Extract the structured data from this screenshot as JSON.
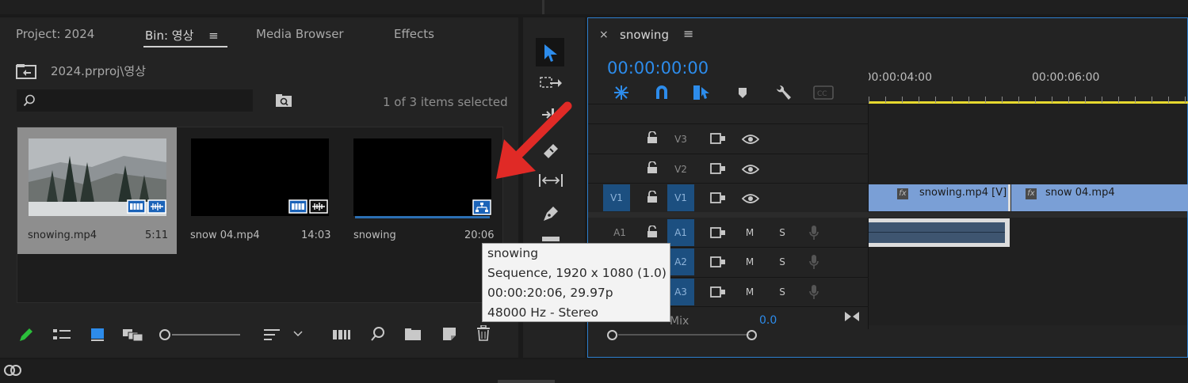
{
  "project_panel": {
    "tabs": [
      "Project: 2024",
      "Bin: 영상",
      "Media Browser",
      "Effects"
    ],
    "active_tab": "Bin: 영상",
    "path": "2024.prproj\\영상",
    "search_placeholder": "",
    "selection_status": "1 of 3 items selected",
    "clips": [
      {
        "name": "snowing.mp4",
        "duration": "5:11",
        "selected": true
      },
      {
        "name": "snow 04.mp4",
        "duration": "14:03",
        "selected": false
      },
      {
        "name": "snowing",
        "duration": "20:06",
        "selected": false
      }
    ]
  },
  "tooltip": {
    "name": "snowing",
    "type": "Sequence, 1920 x 1080 (1.0)",
    "timing": "00:00:20:06, 29.97p",
    "audio": "48000 Hz - Stereo"
  },
  "timeline": {
    "close_symbol": "×",
    "sequence_name": "snowing",
    "timecode": "00:00:00:00",
    "ruler_labels": [
      "00:00:04:00",
      "00:00:06:00"
    ],
    "video_tracks": [
      "V3",
      "V2",
      "V1"
    ],
    "audio_tracks": [
      "A1",
      "A2",
      "A3"
    ],
    "source_patch_v": "V1",
    "source_patch_a": "A1",
    "mute_label": "M",
    "solo_label": "S",
    "mix_label": "Mix",
    "mix_value": "0.0",
    "clips": [
      {
        "name": "snowing.mp4 [V]",
        "fx": "fx"
      },
      {
        "name": "snow 04.mp4",
        "fx": "fx"
      }
    ]
  },
  "colors": {
    "accent_blue": "#2d8ceb",
    "clip_blue": "#7a9fd6",
    "playhead_yellow": "#e6d82f",
    "annotation_red": "#e02a26"
  }
}
